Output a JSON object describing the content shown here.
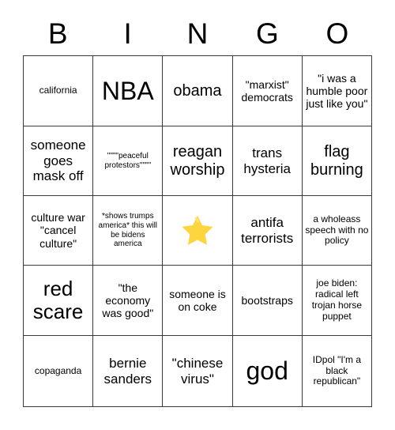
{
  "header": {
    "letters": [
      "B",
      "I",
      "N",
      "G",
      "O"
    ]
  },
  "colors": {
    "grid_line": "#3a3a3a",
    "cell_background": "#ffffff",
    "text": "#000000",
    "star_fill": "#fcd53f",
    "star_highlight": "#ffe36e"
  },
  "grid": {
    "rows": [
      [
        {
          "text": "california",
          "size": "sm",
          "free": false
        },
        {
          "text": "NBA",
          "size": "huge",
          "free": false
        },
        {
          "text": "obama",
          "size": "xl",
          "free": false
        },
        {
          "text": "\"marxist\" democrats",
          "size": "md",
          "free": false
        },
        {
          "text": "\"i was a humble poor just like you\"",
          "size": "md",
          "free": false
        }
      ],
      [
        {
          "text": "someone goes mask off",
          "size": "lg",
          "free": false
        },
        {
          "text": "\"\"\"\"peaceful protestors\"\"\"\"",
          "size": "xs",
          "free": false
        },
        {
          "text": "reagan worship",
          "size": "xl",
          "free": false
        },
        {
          "text": "trans hysteria",
          "size": "lg",
          "free": false
        },
        {
          "text": "flag burning",
          "size": "xl",
          "free": false
        }
      ],
      [
        {
          "text": "culture war \"cancel culture\"",
          "size": "md",
          "free": false
        },
        {
          "text": "*shows trumps america* this will be bidens america",
          "size": "xs",
          "free": false
        },
        {
          "text": "",
          "size": "md",
          "free": true,
          "icon": "star-icon"
        },
        {
          "text": "antifa terrorists",
          "size": "lg",
          "free": false
        },
        {
          "text": "a wholeass speech with no policy",
          "size": "sm",
          "free": false
        }
      ],
      [
        {
          "text": "red scare",
          "size": "xxl",
          "free": false
        },
        {
          "text": "\"the economy was good\"",
          "size": "md",
          "free": false
        },
        {
          "text": "someone is on coke",
          "size": "md",
          "free": false
        },
        {
          "text": "bootstraps",
          "size": "md",
          "free": false
        },
        {
          "text": "joe biden: radical left trojan horse puppet",
          "size": "sm",
          "free": false
        }
      ],
      [
        {
          "text": "copaganda",
          "size": "sm",
          "free": false
        },
        {
          "text": "bernie sanders",
          "size": "lg",
          "free": false
        },
        {
          "text": "\"chinese virus\"",
          "size": "lg",
          "free": false
        },
        {
          "text": "god",
          "size": "huge",
          "free": false
        },
        {
          "text": "IDpol \"I'm a black republican\"",
          "size": "sm",
          "free": false
        }
      ]
    ]
  }
}
